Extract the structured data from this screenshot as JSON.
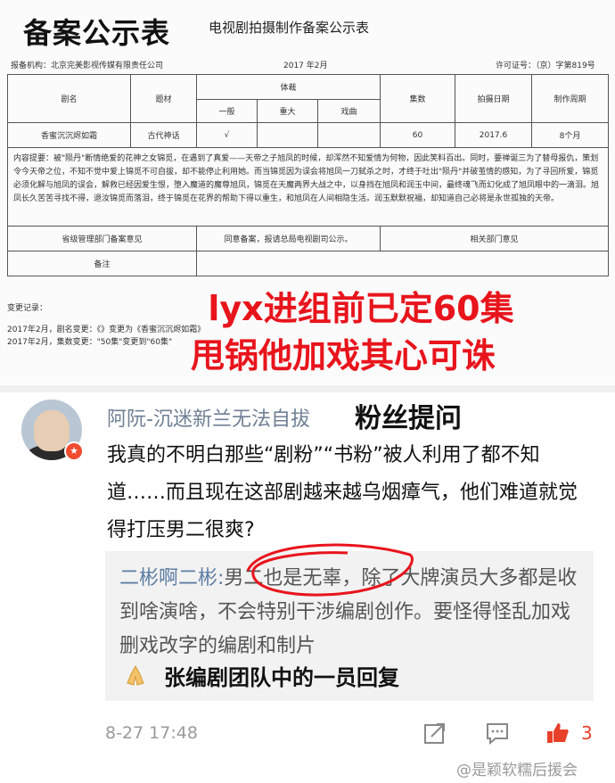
{
  "doc": {
    "title": "备案公示表",
    "subtitle": "电视剧拍摄制作备案公示表",
    "org": "报备机构：北京完美影视传媒有限责任公司",
    "date": "2017 年2月",
    "license": "许可证号：（京）字第819号",
    "headers": {
      "name": "剧名",
      "theme": "题材",
      "genre": "体裁",
      "genre_general": "一般",
      "genre_major": "重大",
      "genre_opera": "戏曲",
      "episodes": "集数",
      "shoot_date": "拍摄日期",
      "cycle": "制作周期"
    },
    "row": {
      "name": "香蜜沉沉烬如霜",
      "theme": "古代神话",
      "general_mark": "√",
      "episodes": "60",
      "shoot_date": "2017.6",
      "cycle": "8个月"
    },
    "synopsis": "内容提要：被\"陨丹\"断情绝爱的花神之女锦觅，在遇到了真爱——天帝之子旭凤的时候，却浑然不知爱情为何物，因此笑料百出。同时，要禅诞三为了替母报仇，策划令今天帝之位，不知不觉中爱上锦觅不可自拔，却不能停止利用她。而当锦觅因为误会将旭凤一刀弑杀之时，才终于吐出\"陨丹\"并破茧情的感知，为了寻回所爱，锦觅必须化解与旭凤的误会，解救已经因爱生恨，堕入魔道的魔尊旭凤，锦觅在天魔两界大战之中，以身挡在旭凤和润玉中间，最终魂飞而幻化成了旭凤眼中的一滴泪。旭凤长久苦苦寻找不得，退汝锦觅而落泪，终于锦觅在花界的帮助下得以重生，和旭凤在人间相隐生活。润玉默默祝福，却知道自己必将是永世孤独的天帝。",
    "dept_opinion_label": "省级管理部门备案意见",
    "dept_opinion": "同意备案，报请总局电视剧司公示。",
    "related_opinion": "相关部门意见",
    "remark_label": "备注",
    "change_log_label": "变更记录：",
    "change_1": "2017年2月，剧名变更：《》变更为《香蜜沉沉烬如霜》",
    "change_2": "2017年2月，集数变更：\"50集\"变更到\"60集\"",
    "overlay_line1": "lyx进组前已定60集",
    "overlay_line2": "甩锅他加戏其心可诛"
  },
  "comment": {
    "avatar_badge": "★",
    "username": "阿阮-沉迷新兰无法自拔",
    "fan_question_label": "粉丝提问",
    "text": "我真的不明白那些“剧粉”“书粉”被人利用了都不知道……而且现在这部剧越来越乌烟瘴气，他们难道就觉得打压男二很爽?",
    "reply": {
      "user": "二彬啊二彬:",
      "text": "男二也是无辜，除了大牌演员大多都是收到啥演啥，不会特别干涉编剧创作。要怪得怪乱加戏删戏改字的编剧和制片",
      "emoji": "pray-hands-emoji",
      "caption": "张编剧团队中的一员回复"
    },
    "timestamp": "8-27 17:48",
    "like_count": "3"
  },
  "watermark": "@是颖软糯后援会",
  "colors": {
    "overlay_red": "#e8141c",
    "username_blue": "#6f7f95",
    "reply_user_blue": "#5c7ea3",
    "like_orange": "#e8402a"
  }
}
